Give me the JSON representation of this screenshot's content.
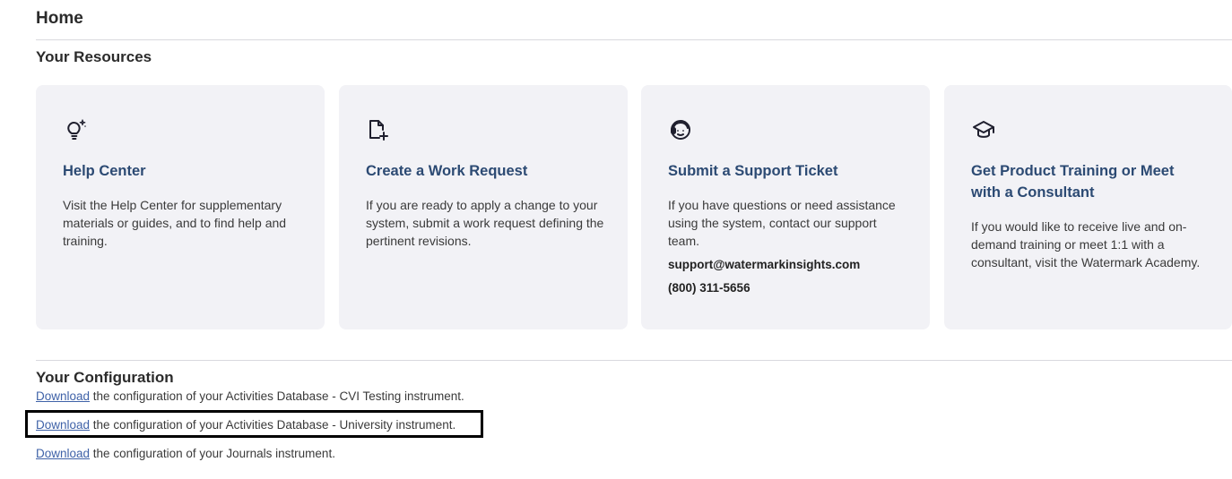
{
  "page": {
    "title": "Home"
  },
  "resources": {
    "heading": "Your Resources",
    "cards": [
      {
        "icon": "lightbulb-sparkle-icon",
        "title": "Help Center",
        "description": "Visit the Help Center for supplementary materials or guides, and to find help and training."
      },
      {
        "icon": "file-add-icon",
        "title": "Create a Work Request",
        "description": "If you are ready to apply a change to your system, submit a work request defining the pertinent revisions."
      },
      {
        "icon": "headset-icon",
        "title": "Submit a Support Ticket",
        "description": "If you have questions or need assistance using the system, contact our support team.",
        "email": "support@watermarkinsights.com",
        "phone": "(800) 311-5656"
      },
      {
        "icon": "graduation-cap-icon",
        "title": "Get Product Training or Meet with a Consultant",
        "description": "If you would like to receive live and on-demand training or meet 1:1 with a consultant, visit the Watermark Academy."
      }
    ]
  },
  "configuration": {
    "heading": "Your Configuration",
    "items": [
      {
        "link_label": "Download",
        "text": " the configuration of your Activities Database - CVI Testing instrument."
      },
      {
        "link_label": "Download",
        "text": " the configuration of your Activities Database - University instrument."
      },
      {
        "link_label": "Download",
        "text": " the configuration of your Journals instrument."
      }
    ]
  },
  "colors": {
    "card_background": "#f2f2f6",
    "card_title": "#2c4a73",
    "link": "#3f62a8",
    "highlight_border": "#000000"
  }
}
